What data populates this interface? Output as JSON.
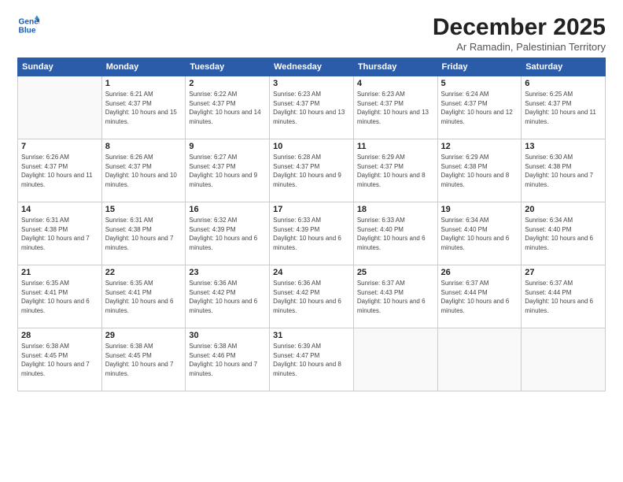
{
  "logo": {
    "line1": "General",
    "line2": "Blue"
  },
  "title": "December 2025",
  "subtitle": "Ar Ramadin, Palestinian Territory",
  "headers": [
    "Sunday",
    "Monday",
    "Tuesday",
    "Wednesday",
    "Thursday",
    "Friday",
    "Saturday"
  ],
  "weeks": [
    [
      {
        "day": "",
        "empty": true
      },
      {
        "day": "1",
        "sunrise": "6:21 AM",
        "sunset": "4:37 PM",
        "daylight": "10 hours and 15 minutes."
      },
      {
        "day": "2",
        "sunrise": "6:22 AM",
        "sunset": "4:37 PM",
        "daylight": "10 hours and 14 minutes."
      },
      {
        "day": "3",
        "sunrise": "6:23 AM",
        "sunset": "4:37 PM",
        "daylight": "10 hours and 13 minutes."
      },
      {
        "day": "4",
        "sunrise": "6:23 AM",
        "sunset": "4:37 PM",
        "daylight": "10 hours and 13 minutes."
      },
      {
        "day": "5",
        "sunrise": "6:24 AM",
        "sunset": "4:37 PM",
        "daylight": "10 hours and 12 minutes."
      },
      {
        "day": "6",
        "sunrise": "6:25 AM",
        "sunset": "4:37 PM",
        "daylight": "10 hours and 11 minutes."
      }
    ],
    [
      {
        "day": "7",
        "sunrise": "6:26 AM",
        "sunset": "4:37 PM",
        "daylight": "10 hours and 11 minutes."
      },
      {
        "day": "8",
        "sunrise": "6:26 AM",
        "sunset": "4:37 PM",
        "daylight": "10 hours and 10 minutes."
      },
      {
        "day": "9",
        "sunrise": "6:27 AM",
        "sunset": "4:37 PM",
        "daylight": "10 hours and 9 minutes."
      },
      {
        "day": "10",
        "sunrise": "6:28 AM",
        "sunset": "4:37 PM",
        "daylight": "10 hours and 9 minutes."
      },
      {
        "day": "11",
        "sunrise": "6:29 AM",
        "sunset": "4:37 PM",
        "daylight": "10 hours and 8 minutes."
      },
      {
        "day": "12",
        "sunrise": "6:29 AM",
        "sunset": "4:38 PM",
        "daylight": "10 hours and 8 minutes."
      },
      {
        "day": "13",
        "sunrise": "6:30 AM",
        "sunset": "4:38 PM",
        "daylight": "10 hours and 7 minutes."
      }
    ],
    [
      {
        "day": "14",
        "sunrise": "6:31 AM",
        "sunset": "4:38 PM",
        "daylight": "10 hours and 7 minutes."
      },
      {
        "day": "15",
        "sunrise": "6:31 AM",
        "sunset": "4:38 PM",
        "daylight": "10 hours and 7 minutes."
      },
      {
        "day": "16",
        "sunrise": "6:32 AM",
        "sunset": "4:39 PM",
        "daylight": "10 hours and 6 minutes."
      },
      {
        "day": "17",
        "sunrise": "6:33 AM",
        "sunset": "4:39 PM",
        "daylight": "10 hours and 6 minutes."
      },
      {
        "day": "18",
        "sunrise": "6:33 AM",
        "sunset": "4:40 PM",
        "daylight": "10 hours and 6 minutes."
      },
      {
        "day": "19",
        "sunrise": "6:34 AM",
        "sunset": "4:40 PM",
        "daylight": "10 hours and 6 minutes."
      },
      {
        "day": "20",
        "sunrise": "6:34 AM",
        "sunset": "4:40 PM",
        "daylight": "10 hours and 6 minutes."
      }
    ],
    [
      {
        "day": "21",
        "sunrise": "6:35 AM",
        "sunset": "4:41 PM",
        "daylight": "10 hours and 6 minutes."
      },
      {
        "day": "22",
        "sunrise": "6:35 AM",
        "sunset": "4:41 PM",
        "daylight": "10 hours and 6 minutes."
      },
      {
        "day": "23",
        "sunrise": "6:36 AM",
        "sunset": "4:42 PM",
        "daylight": "10 hours and 6 minutes."
      },
      {
        "day": "24",
        "sunrise": "6:36 AM",
        "sunset": "4:42 PM",
        "daylight": "10 hours and 6 minutes."
      },
      {
        "day": "25",
        "sunrise": "6:37 AM",
        "sunset": "4:43 PM",
        "daylight": "10 hours and 6 minutes."
      },
      {
        "day": "26",
        "sunrise": "6:37 AM",
        "sunset": "4:44 PM",
        "daylight": "10 hours and 6 minutes."
      },
      {
        "day": "27",
        "sunrise": "6:37 AM",
        "sunset": "4:44 PM",
        "daylight": "10 hours and 6 minutes."
      }
    ],
    [
      {
        "day": "28",
        "sunrise": "6:38 AM",
        "sunset": "4:45 PM",
        "daylight": "10 hours and 7 minutes."
      },
      {
        "day": "29",
        "sunrise": "6:38 AM",
        "sunset": "4:45 PM",
        "daylight": "10 hours and 7 minutes."
      },
      {
        "day": "30",
        "sunrise": "6:38 AM",
        "sunset": "4:46 PM",
        "daylight": "10 hours and 7 minutes."
      },
      {
        "day": "31",
        "sunrise": "6:39 AM",
        "sunset": "4:47 PM",
        "daylight": "10 hours and 8 minutes."
      },
      {
        "day": "",
        "empty": true
      },
      {
        "day": "",
        "empty": true
      },
      {
        "day": "",
        "empty": true
      }
    ]
  ]
}
